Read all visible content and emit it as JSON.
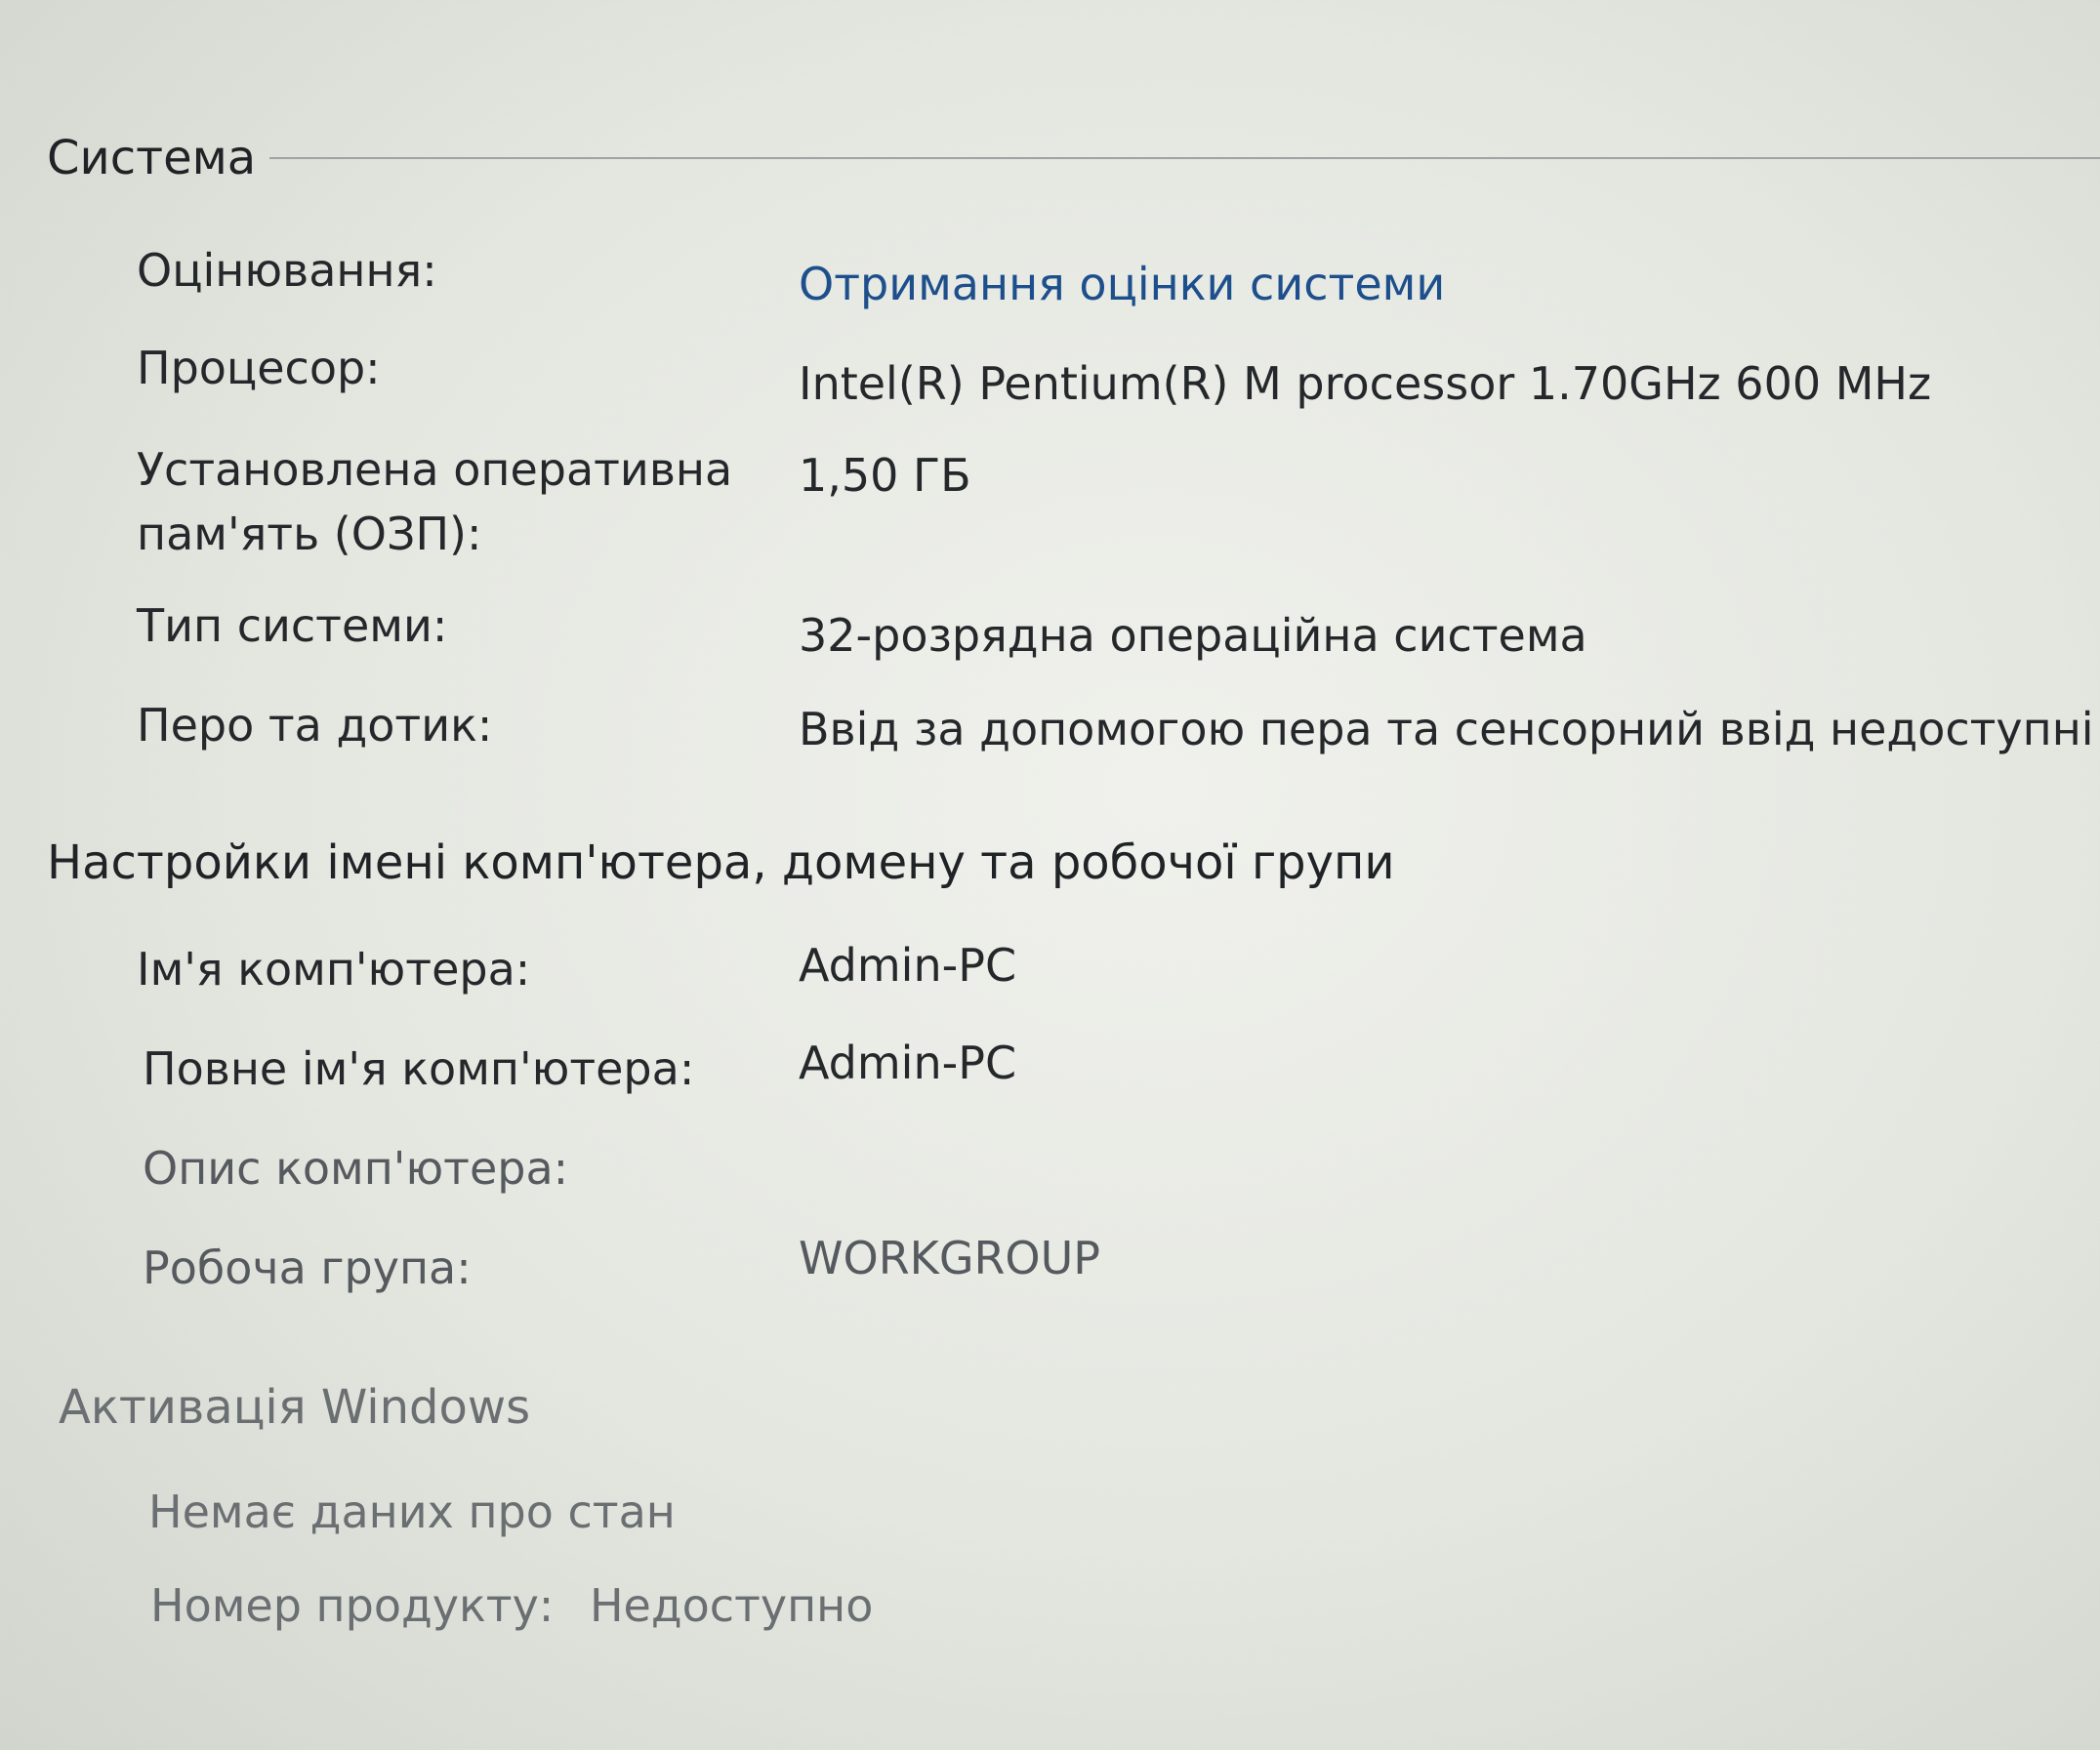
{
  "system": {
    "title": "Система",
    "rows": [
      {
        "label": "Оцінювання:",
        "value": "Отримання оцінки системи",
        "is_link": true
      },
      {
        "label": "Процесор:",
        "value": "Intel(R) Pentium(R) M processor 1.70GHz   600 MHz"
      },
      {
        "label": "Установлена оперативна пам'ять (ОЗП):",
        "value": "1,50 ГБ"
      },
      {
        "label": "Тип системи:",
        "value": "32-розрядна операційна система"
      },
      {
        "label": "Перо та дотик:",
        "value": "Ввід за допомогою пера та сенсорний ввід недоступні на"
      }
    ]
  },
  "computer": {
    "title": "Настройки імені комп'ютера, домену та робочої групи",
    "rows": [
      {
        "label": "Ім'я комп'ютера:",
        "value": "Admin-PC"
      },
      {
        "label": "Повне ім'я комп'ютера:",
        "value": "Admin-PC"
      },
      {
        "label": "Опис комп'ютера:",
        "value": ""
      },
      {
        "label": "Робоча група:",
        "value": "WORKGROUP"
      }
    ]
  },
  "activation": {
    "title": "Активація Windows",
    "status": "Немає даних про стан",
    "product_label": "Номер продукту:",
    "product_value": "Недоступно"
  },
  "colors": {
    "link": "#1d4f8c",
    "text": "#25282b",
    "background": "#e4e6e0"
  }
}
